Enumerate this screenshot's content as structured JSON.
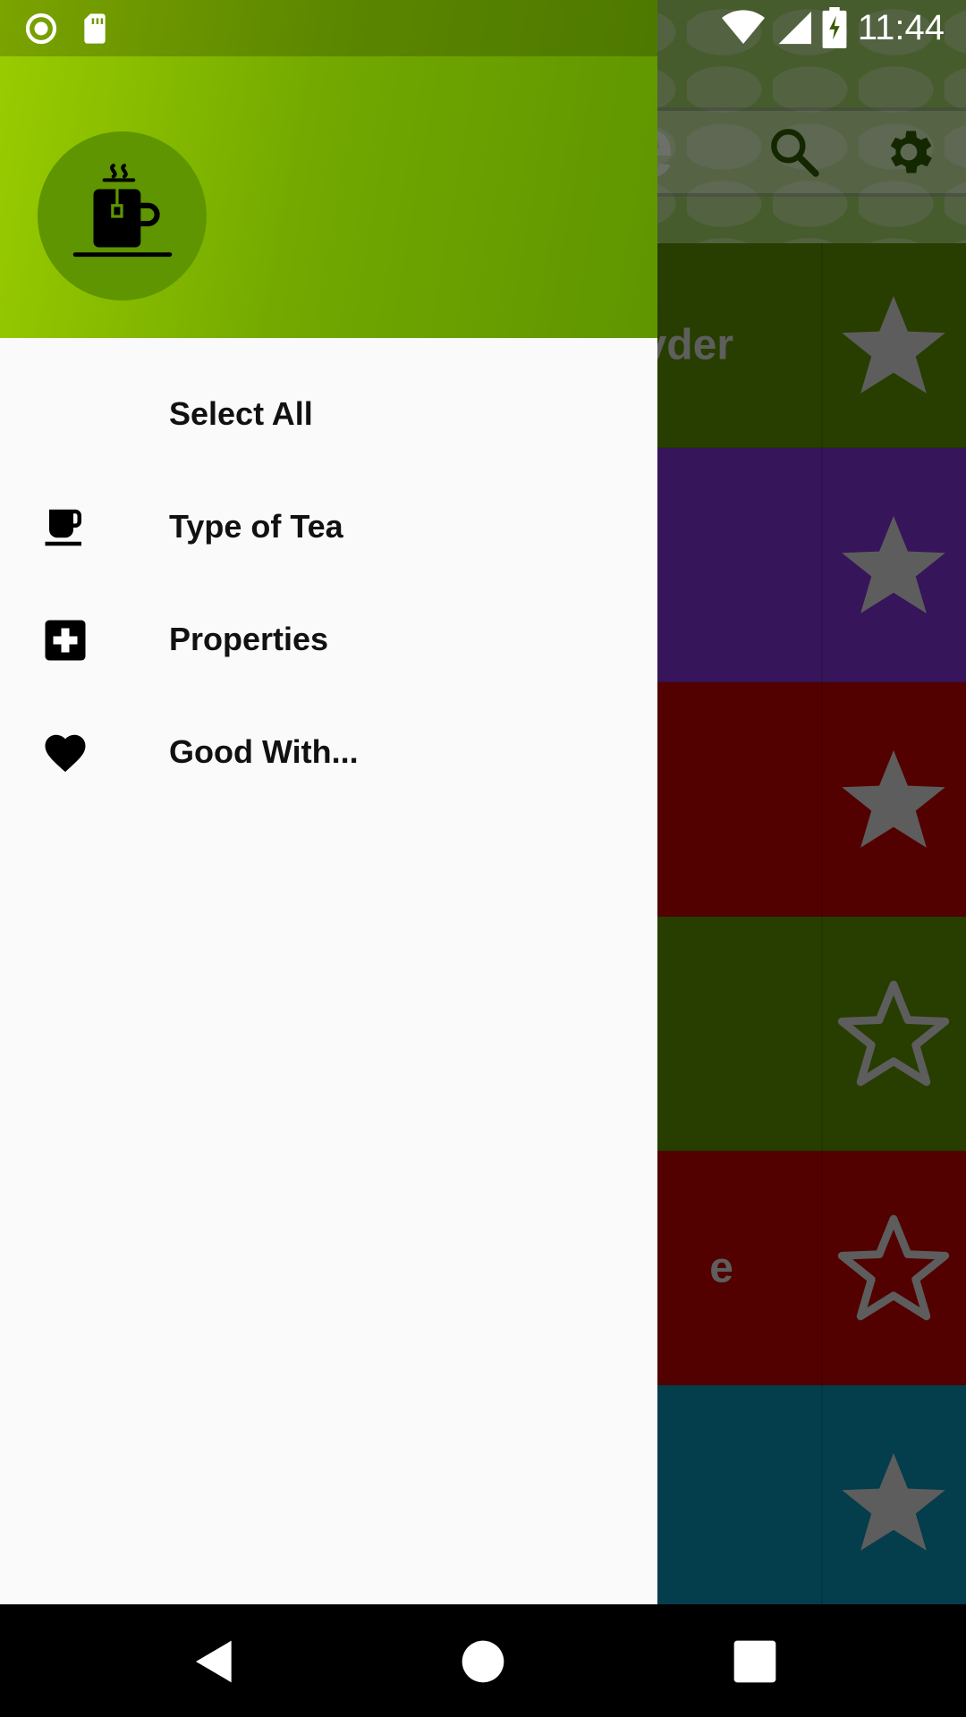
{
  "status_bar": {
    "time": "11:44",
    "icons": [
      "record-icon",
      "sd-card-icon",
      "wifi-icon",
      "signal-icon",
      "battery-charging-icon"
    ]
  },
  "app": {
    "title_fragment": "e",
    "toolbar_icons": [
      "search-icon",
      "settings-icon"
    ],
    "accent_color": "#9ccc65",
    "tea_rows": [
      {
        "name_fragment": "vder",
        "color": "#5a8a00",
        "favorite": true
      },
      {
        "name_fragment": "",
        "color": "#7b2fc7",
        "favorite": true
      },
      {
        "name_fragment": "",
        "color": "#b80000",
        "favorite": true
      },
      {
        "name_fragment": "",
        "color": "#5a8a00",
        "favorite": false
      },
      {
        "name_fragment": "e",
        "color": "#b80000",
        "favorite": false
      },
      {
        "name_fragment": "",
        "color": "#0a88a8",
        "favorite": true
      }
    ]
  },
  "drawer": {
    "header_icon": "tea-mug-icon",
    "header_colors": [
      "#9acd00",
      "#5f9500"
    ],
    "menu": [
      {
        "label": "Select All",
        "icon": ""
      },
      {
        "label": "Type of Tea",
        "icon": "coffee-cup-icon"
      },
      {
        "label": "Properties",
        "icon": "medical-cross-icon"
      },
      {
        "label": "Good With...",
        "icon": "heart-icon"
      }
    ]
  },
  "nav_bar": {
    "buttons": [
      "back-icon",
      "home-icon",
      "recents-icon"
    ]
  }
}
